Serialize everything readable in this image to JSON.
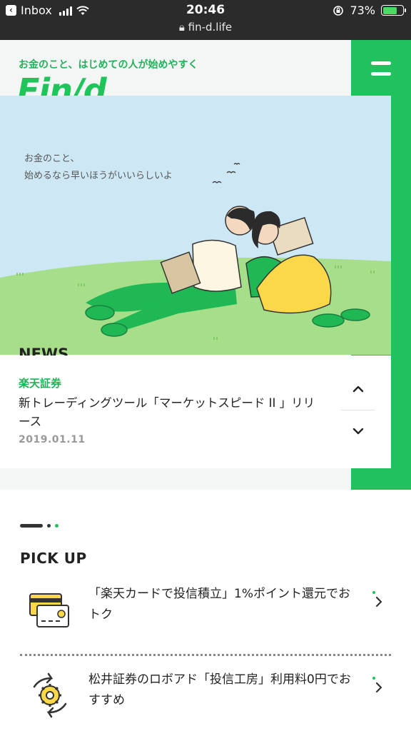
{
  "status_bar": {
    "back_app": "Inbox",
    "time": "20:46",
    "url": "fin-d.life",
    "battery": "73%",
    "battery_level": 0.73
  },
  "header": {
    "tagline": "お金のこと、はじめての人が始めやすく",
    "logo": "Fin/d"
  },
  "hero": {
    "caption_line1": "お金のこと、",
    "caption_line2": "始めるなら早いほうがいいらしいよ"
  },
  "news": {
    "section_title": "NEWS",
    "category": "楽天証券",
    "headline": "新トレーディングツール「マーケットスピード II 」リリース",
    "date": "2019.01.11"
  },
  "pickup": {
    "section_title": "PICK UP",
    "items": [
      {
        "text": "「楽天カードで投信積立」1%ポイント還元でおトク",
        "icon": "credit-card-icon"
      },
      {
        "text": "松井証券のロボアド「投信工房」利用料0円でおすすめ",
        "icon": "gear-cycle-icon"
      }
    ]
  },
  "colors": {
    "brand_green": "#21c25e",
    "status_bar": "#2b2b2b",
    "sky": "#cde8f4",
    "grass": "#9fdc83"
  }
}
